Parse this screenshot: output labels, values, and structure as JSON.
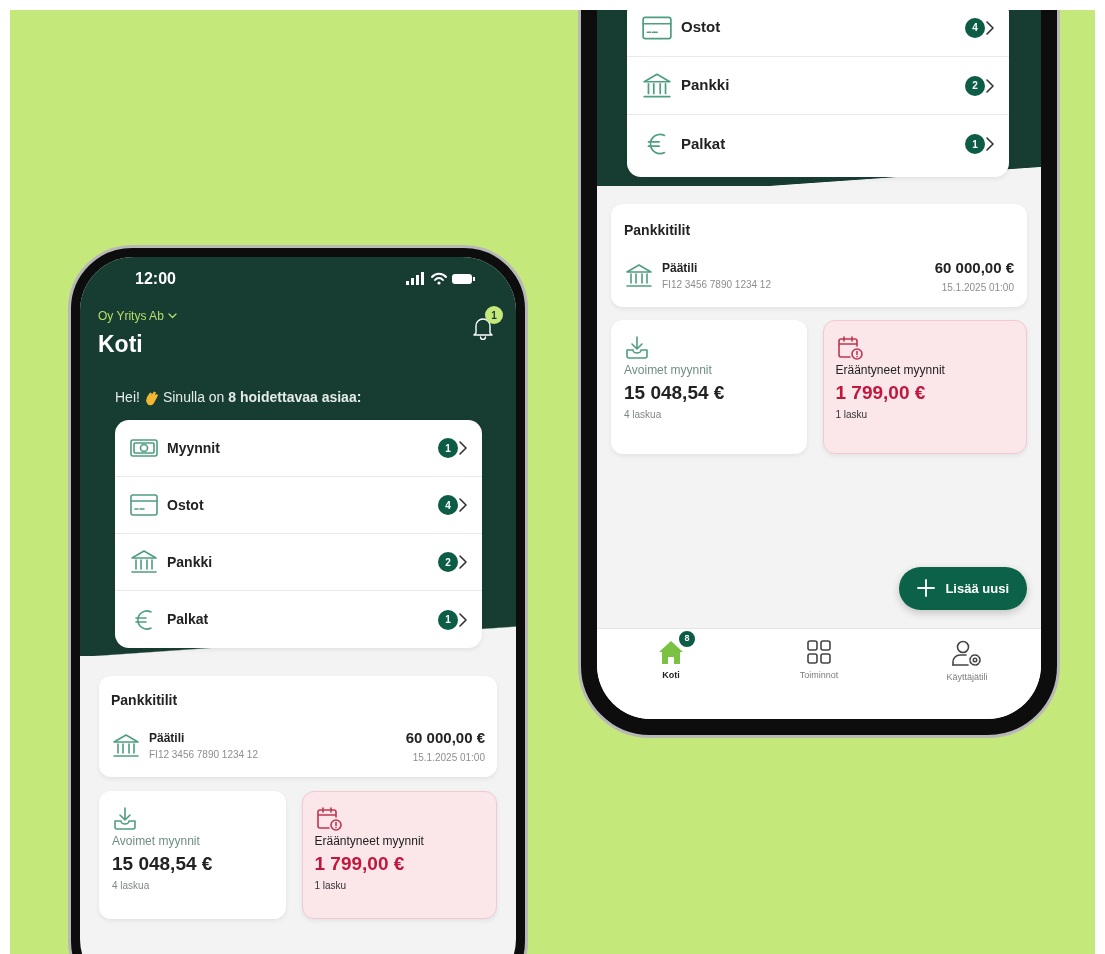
{
  "phones": [
    {
      "status_bar": {
        "time": "12:00"
      },
      "header": {
        "company": "Oy Yritys Ab",
        "title": "Koti",
        "notification_count": "1"
      },
      "greeting": {
        "start": "Hei!",
        "text": "Sinulla on **8 hoidettavaa asiaa:**"
      },
      "todo_items": [
        {
          "kind": "cash",
          "label": "Myynnit",
          "count": "1"
        },
        {
          "kind": "card",
          "label": "Ostot",
          "count": "4"
        },
        {
          "kind": "bank",
          "label": "Pankki",
          "count": "2"
        },
        {
          "kind": "euro",
          "label": "Palkat",
          "count": "1"
        }
      ],
      "bank_accounts": {
        "title": "Pankkitilit",
        "accounts": [
          {
            "name": "Päätili",
            "iban": "FI12 3456 7890 1234 12",
            "balance": "60 000,00 €",
            "date": "15.1.2025 01:00"
          }
        ]
      },
      "tiles": [
        {
          "kind": "open",
          "title": "Avoimet myynnit",
          "amount": "15 048,54 €",
          "subtitle": "4 laskua"
        },
        {
          "kind": "overdue",
          "title": "Erääntyneet myynnit",
          "amount": "1 799,00 €",
          "subtitle": "1 lasku"
        }
      ]
    },
    {
      "todo_items": [
        {
          "kind": "card",
          "label": "Ostot",
          "count": "4"
        },
        {
          "kind": "bank",
          "label": "Pankki",
          "count": "2"
        },
        {
          "kind": "euro",
          "label": "Palkat",
          "count": "1"
        }
      ],
      "bank_accounts": {
        "title": "Pankkitilit",
        "accounts": [
          {
            "name": "Päätili",
            "iban": "FI12 3456 7890 1234 12",
            "balance": "60 000,00 €",
            "date": "15.1.2025 01:00"
          }
        ]
      },
      "tiles": [
        {
          "kind": "open",
          "title": "Avoimet myynnit",
          "amount": "15 048,54 €",
          "subtitle": "4 laskua"
        },
        {
          "kind": "overdue",
          "title": "Erääntyneet myynnit",
          "amount": "1 799,00 €",
          "subtitle": "1 lasku"
        }
      ],
      "fab": {
        "label": "Lisää uusi"
      },
      "bottom_nav": [
        {
          "kind": "home",
          "label": "Koti",
          "selected": true,
          "badge": "8"
        },
        {
          "kind": "grid",
          "label": "Toiminnot",
          "selected": false
        },
        {
          "kind": "user",
          "label": "Käyttäjätili",
          "selected": false
        }
      ]
    }
  ]
}
